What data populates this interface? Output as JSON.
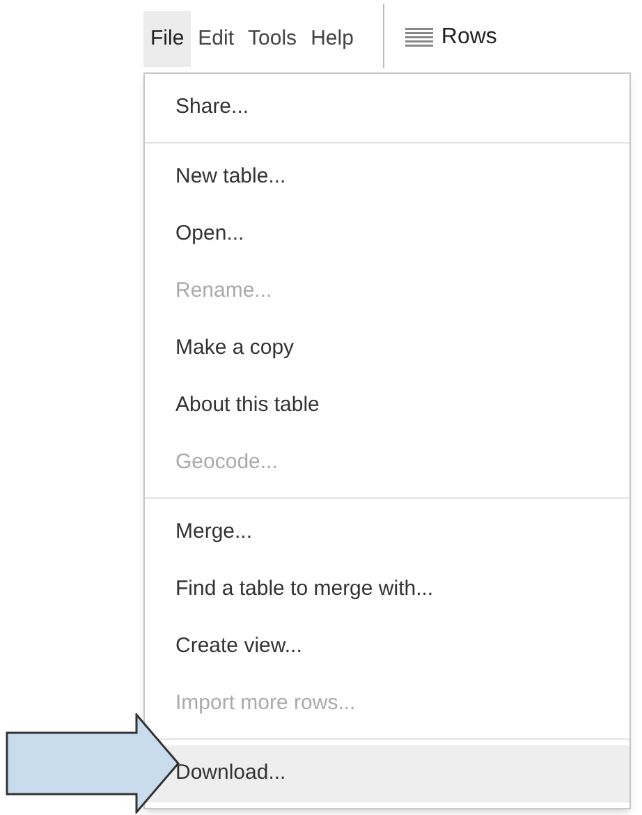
{
  "menubar": [
    {
      "label": "File",
      "selected": true
    },
    {
      "label": "Edit",
      "selected": false
    },
    {
      "label": "Tools",
      "selected": false
    },
    {
      "label": "Help",
      "selected": false
    }
  ],
  "rows_button": {
    "label": "Rows"
  },
  "file_menu": {
    "sections": [
      {
        "items": [
          {
            "label": "Share...",
            "disabled": false,
            "highlighted": false
          }
        ]
      },
      {
        "items": [
          {
            "label": "New table...",
            "disabled": false,
            "highlighted": false
          },
          {
            "label": "Open...",
            "disabled": false,
            "highlighted": false
          },
          {
            "label": "Rename...",
            "disabled": true,
            "highlighted": false
          },
          {
            "label": "Make a copy",
            "disabled": false,
            "highlighted": false
          },
          {
            "label": "About this table",
            "disabled": false,
            "highlighted": false
          },
          {
            "label": "Geocode...",
            "disabled": true,
            "highlighted": false
          }
        ]
      },
      {
        "items": [
          {
            "label": "Merge...",
            "disabled": false,
            "highlighted": false
          },
          {
            "label": "Find a table to merge with...",
            "disabled": false,
            "highlighted": false
          },
          {
            "label": "Create view...",
            "disabled": false,
            "highlighted": false
          },
          {
            "label": "Import more rows...",
            "disabled": true,
            "highlighted": false
          }
        ]
      },
      {
        "items": [
          {
            "label": "Download...",
            "disabled": false,
            "highlighted": true
          }
        ]
      }
    ]
  }
}
